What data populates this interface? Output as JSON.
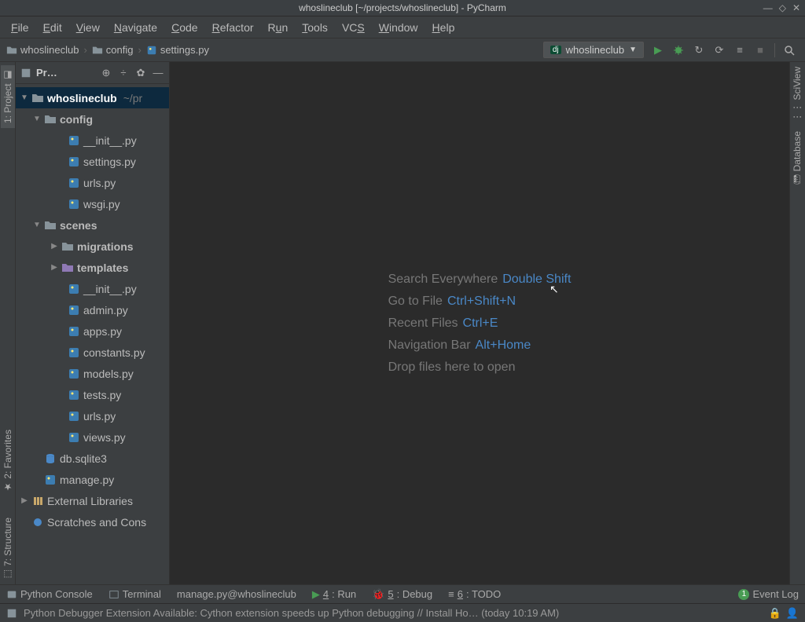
{
  "window": {
    "title": "whoslineclub [~/projects/whoslineclub] - PyCharm"
  },
  "menu": [
    "File",
    "Edit",
    "View",
    "Navigate",
    "Code",
    "Refactor",
    "Run",
    "Tools",
    "VCS",
    "Window",
    "Help"
  ],
  "breadcrumbs": [
    {
      "icon": "folder",
      "label": "whoslineclub"
    },
    {
      "icon": "folder",
      "label": "config"
    },
    {
      "icon": "pyfile",
      "label": "settings.py"
    }
  ],
  "runconfig": {
    "label": "whoslineclub"
  },
  "left_tabs": {
    "project": "1: Project",
    "structure": "7: Structure",
    "favorites": "2: Favorites"
  },
  "right_tabs": {
    "sciview": "SciView",
    "database": "Database"
  },
  "sidebar": {
    "header": "Pr…"
  },
  "tree": {
    "root": {
      "name": "whoslineclub",
      "path": "~/pr"
    },
    "config": {
      "name": "config",
      "files": [
        "__init__.py",
        "settings.py",
        "urls.py",
        "wsgi.py"
      ]
    },
    "scenes": {
      "name": "scenes",
      "dirs": [
        "migrations",
        "templates"
      ],
      "files": [
        "__init__.py",
        "admin.py",
        "apps.py",
        "constants.py",
        "models.py",
        "tests.py",
        "urls.py",
        "views.py"
      ]
    },
    "db": "db.sqlite3",
    "manage": "manage.py",
    "ext": "External Libraries",
    "scratch": "Scratches and Cons"
  },
  "welcome": {
    "search": {
      "label": "Search Everywhere",
      "key": "Double Shift"
    },
    "gotofile": {
      "label": "Go to File",
      "key": "Ctrl+Shift+N"
    },
    "recent": {
      "label": "Recent Files",
      "key": "Ctrl+E"
    },
    "navbar": {
      "label": "Navigation Bar",
      "key": "Alt+Home"
    },
    "drop": "Drop files here to open"
  },
  "bottom": {
    "console": "Python Console",
    "terminal": "Terminal",
    "manage": "manage.py@whoslineclub",
    "run": "4: Run",
    "debug": "5: Debug",
    "todo": "6: TODO",
    "eventlog": "Event Log",
    "eventcount": "1"
  },
  "status": {
    "msg": "Python Debugger Extension Available: Cython extension speeds up Python debugging // Install Ho… (today 10:19 AM)"
  }
}
